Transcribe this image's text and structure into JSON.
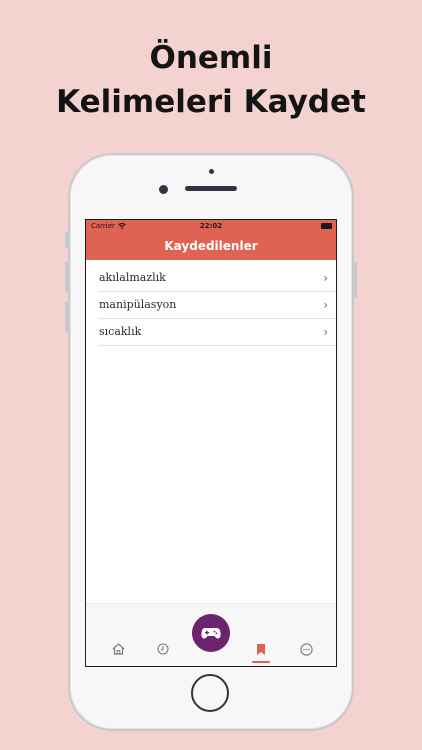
{
  "headline": {
    "line1": "Önemli",
    "line2": "Kelimeleri Kaydet"
  },
  "status_bar": {
    "carrier": "Carrier",
    "time": "22:02"
  },
  "nav": {
    "title": "Kaydedilenler"
  },
  "saved_words": [
    {
      "word": "akılalmazlık"
    },
    {
      "word": "manipülasyon"
    },
    {
      "word": "sıcaklık"
    }
  ],
  "tab_bar": {
    "tabs": [
      {
        "icon": "home-icon"
      },
      {
        "icon": "clock-icon"
      },
      {
        "icon": "gamepad-icon"
      },
      {
        "icon": "bookmark-icon",
        "active": true
      },
      {
        "icon": "more-icon"
      }
    ]
  },
  "colors": {
    "background": "#f3d2cf",
    "accent": "#de6353",
    "game_button": "#6d246f"
  }
}
